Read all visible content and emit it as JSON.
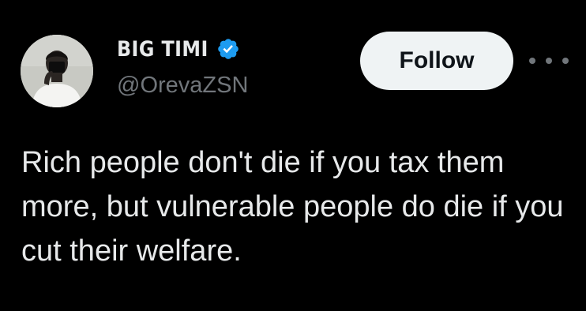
{
  "tweet": {
    "author": {
      "display_name": "BIG TIMI",
      "handle": "@OrevaZSN",
      "verified": true,
      "avatar_icon": "profile-photo"
    },
    "follow_label": "Follow",
    "more_icon": "more-horizontal-icon",
    "text": "Rich people don't die if you tax them more, but vulnerable people do die if you cut their welfare."
  },
  "colors": {
    "background": "#000000",
    "text_primary": "#e7e9ea",
    "text_secondary": "#71767b",
    "verified_blue": "#1d9bf0",
    "follow_bg": "#eff3f4",
    "follow_text": "#0f1419"
  }
}
